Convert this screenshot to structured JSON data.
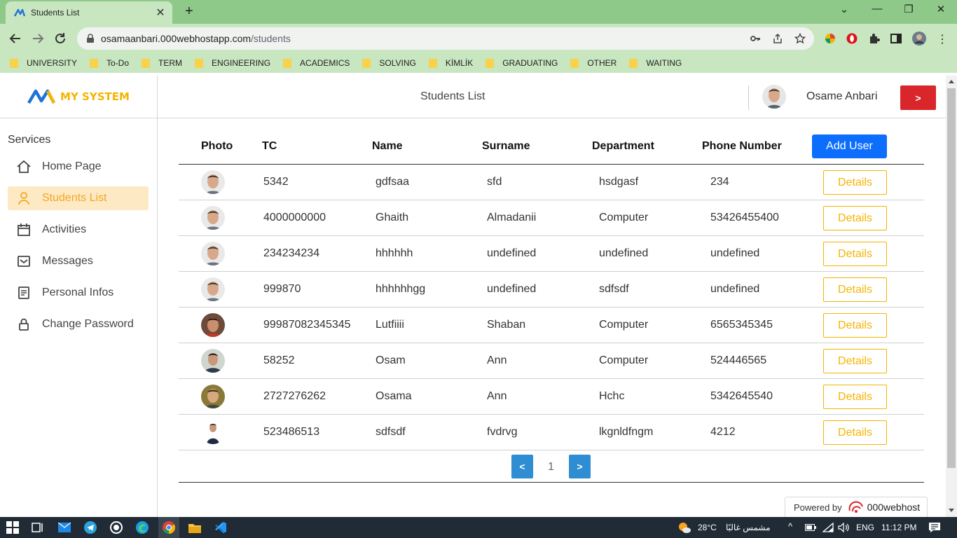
{
  "browser": {
    "tab_title": "Students List",
    "tab_close": "✕",
    "new_tab": "+",
    "window_controls": [
      "⌄",
      "—",
      "❐",
      "✕"
    ],
    "url_host": "osamaanbari.000webhostapp.com",
    "url_path": "/students",
    "bookmarks": [
      "UNIVERSITY",
      "To-Do",
      "TERM",
      "ENGINEERING",
      "ACADEMICS",
      "SOLVING",
      "KİMLİK",
      "GRADUATING",
      "OTHER",
      "WAITING"
    ]
  },
  "logo": {
    "text": "MY SYSTEM",
    "color": "#f5b400"
  },
  "sidebar": {
    "title": "Services",
    "items": [
      {
        "label": "Home Page",
        "icon": "home-icon"
      },
      {
        "label": "Students List",
        "icon": "user-icon",
        "active": true
      },
      {
        "label": "Activities",
        "icon": "calendar-icon"
      },
      {
        "label": "Messages",
        "icon": "mail-icon"
      },
      {
        "label": "Personal Infos",
        "icon": "document-icon"
      },
      {
        "label": "Change Password",
        "icon": "lock-icon"
      }
    ]
  },
  "header": {
    "title": "Students List",
    "user_name": "Osame Anbari",
    "logout_label": ">"
  },
  "table": {
    "columns": [
      "Photo",
      "TC",
      "Name",
      "Surname",
      "Department",
      "Phone Number"
    ],
    "add_label": "Add User",
    "details_label": "Details",
    "rows": [
      {
        "tc": "5342",
        "name": "gdfsaa",
        "surname": "sfd",
        "department": "hsdgasf",
        "phone": "234"
      },
      {
        "tc": "4000000000",
        "name": "Ghaith",
        "surname": "Almadanii",
        "department": "Computer",
        "phone": "53426455400"
      },
      {
        "tc": "234234234",
        "name": "hhhhhh",
        "surname": "undefined",
        "department": "undefined",
        "phone": "undefined"
      },
      {
        "tc": "999870",
        "name": "hhhhhhgg",
        "surname": "undefined",
        "department": "sdfsdf",
        "phone": "undefined"
      },
      {
        "tc": "99987082345345",
        "name": "Lutfiiii",
        "surname": "Shaban",
        "department": "Computer",
        "phone": "6565345345"
      },
      {
        "tc": "58252",
        "name": "Osam",
        "surname": "Ann",
        "department": "Computer",
        "phone": "524446565"
      },
      {
        "tc": "2727276262",
        "name": "Osama",
        "surname": "Ann",
        "department": "Hchc",
        "phone": "5342645540"
      },
      {
        "tc": "523486513",
        "name": "sdfsdf",
        "surname": "fvdrvg",
        "department": "lkgnldfngm",
        "phone": "4212"
      }
    ]
  },
  "pagination": {
    "prev": "<",
    "page": "1",
    "next": ">"
  },
  "powered": {
    "label": "Powered by",
    "brand": "000webhost"
  },
  "taskbar": {
    "weather": "28°C",
    "weather_desc": "مشمس غالبًا",
    "lang": "ENG",
    "time": "11:12 PM"
  },
  "colors": {
    "accent": "#f5b400",
    "primary": "#0d6efd",
    "danger": "#d9262b",
    "pager": "#2f8ed3",
    "chrome": "#8fc98a"
  }
}
